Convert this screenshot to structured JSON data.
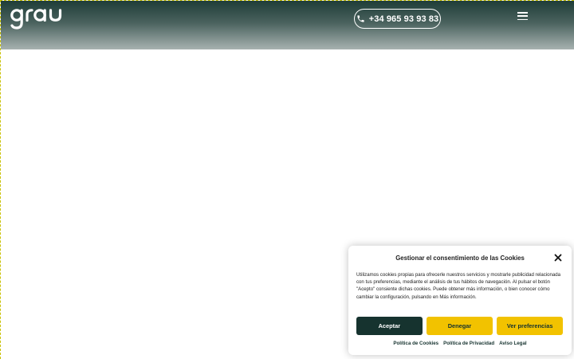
{
  "header": {
    "logo_text": "grau",
    "phone_label": "+34 965 93 93 83",
    "phone_icon": "phone-icon",
    "menu_icon": "hamburger-menu-icon"
  },
  "cookie_banner": {
    "title": "Gestionar el consentimiento de las Cookies",
    "close_icon": "close-icon",
    "body": "Utilizamos cookies propias para ofrecerle nuestros servicios y mostrarle publicidad relacionada con tus preferencias, mediante el análisis de tus hábitos de navegación. Al pulsar el botón \"Acepto\" consiente dichas cookies. Puede obtener más información, o bien conocer cómo cambiar la configuración, pulsando en Más información.",
    "accept_label": "Aceptar",
    "deny_label": "Denegar",
    "preferences_label": "Ver preferencias",
    "links": [
      "Política de Cookies",
      "Política de Privacidad",
      "Aviso Legal"
    ]
  },
  "colors": {
    "brand_dark": "#16332f",
    "brand_yellow": "#f2c200",
    "header_top": "#1f3d38"
  }
}
